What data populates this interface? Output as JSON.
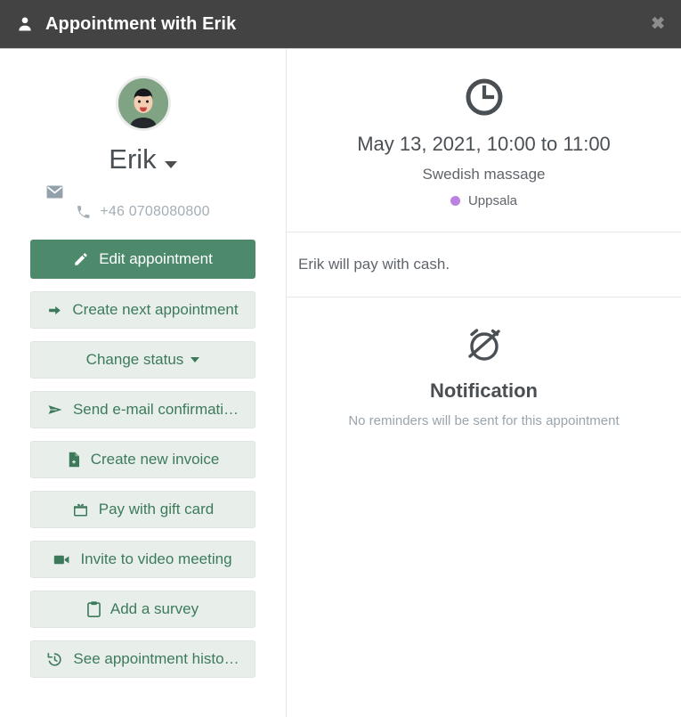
{
  "header": {
    "person_icon": "person-icon",
    "title": "Appointment with Erik",
    "close_label": "✖"
  },
  "client": {
    "avatar_icon": "avatar-cartoon-face",
    "name": "Erik",
    "name_caret_icon": "chevron-down-icon",
    "email_icon": "envelope-icon",
    "email_value": "",
    "phone_icon": "phone-icon",
    "phone": "+46 0708080800"
  },
  "actions": [
    {
      "id": "edit-appointment",
      "label": "Edit appointment",
      "icon": "pencil-icon",
      "style": "primary",
      "caret": false
    },
    {
      "id": "create-next-appointment",
      "label": "Create next appointment",
      "icon": "arrow-right-icon",
      "style": "secondary",
      "caret": false
    },
    {
      "id": "change-status",
      "label": "Change status",
      "icon": "",
      "style": "secondary",
      "caret": true
    },
    {
      "id": "send-email-confirmation",
      "label": "Send e-mail confirmati…",
      "icon": "paper-plane-icon",
      "style": "secondary",
      "caret": false
    },
    {
      "id": "create-new-invoice",
      "label": "Create new invoice",
      "icon": "file-plus-icon",
      "style": "secondary",
      "caret": false
    },
    {
      "id": "pay-with-gift-card",
      "label": "Pay with gift card",
      "icon": "gift-card-icon",
      "style": "secondary",
      "caret": false
    },
    {
      "id": "invite-to-video-meeting",
      "label": "Invite to video meeting",
      "icon": "video-camera-icon",
      "style": "secondary",
      "caret": false
    },
    {
      "id": "add-a-survey",
      "label": "Add a survey",
      "icon": "clipboard-icon",
      "style": "secondary",
      "caret": false
    },
    {
      "id": "see-appointment-history",
      "label": "See appointment histo…",
      "icon": "history-icon",
      "style": "secondary",
      "caret": false
    }
  ],
  "appointment": {
    "clock_icon": "clock-icon",
    "datetime": "May 13, 2021, 10:00 to 11:00",
    "service": "Swedish massage",
    "location": "Uppsala",
    "location_dot_color": "#bb80e0"
  },
  "note": {
    "text": "Erik will pay with cash."
  },
  "notification": {
    "icon": "alarm-off-icon",
    "title": "Notification",
    "subtitle": "No reminders will be sent for this appointment"
  },
  "colors": {
    "header_bg": "#434343",
    "primary_green": "#4d8a6c",
    "secondary_bg": "#e8efea",
    "secondary_text": "#3d7a5c",
    "text_dark": "#4a4f54",
    "text_muted": "#9aa4ac"
  }
}
